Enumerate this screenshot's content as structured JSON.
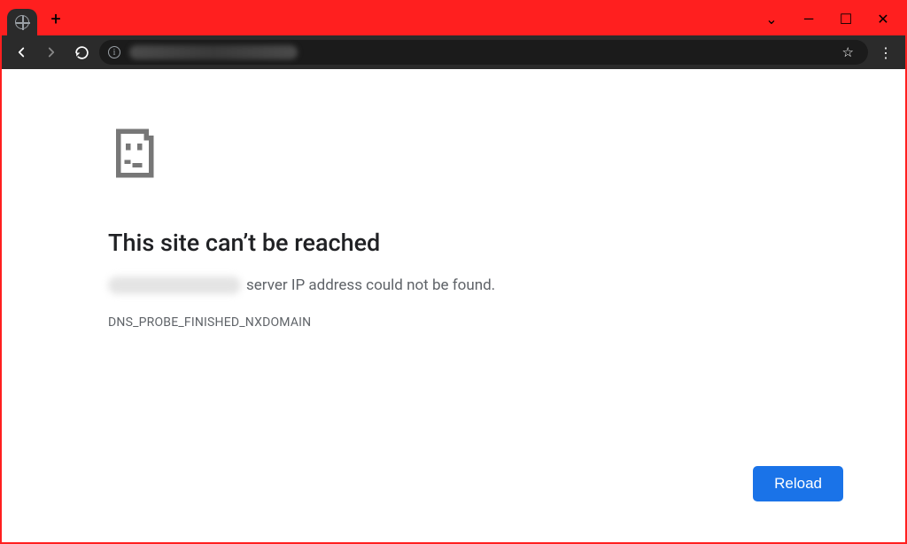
{
  "window": {
    "new_tab_tooltip": "+",
    "controls": {
      "dropdown": "⌄",
      "minimize": "—",
      "maximize": "☐",
      "close": "✕"
    }
  },
  "toolbar": {
    "info_hint": "i",
    "star_glyph": "☆",
    "menu_glyph": "⋮"
  },
  "error": {
    "title": "This site can’t be reached",
    "message_suffix": " server IP address could not be found.",
    "code": "DNS_PROBE_FINISHED_NXDOMAIN",
    "reload_label": "Reload"
  }
}
